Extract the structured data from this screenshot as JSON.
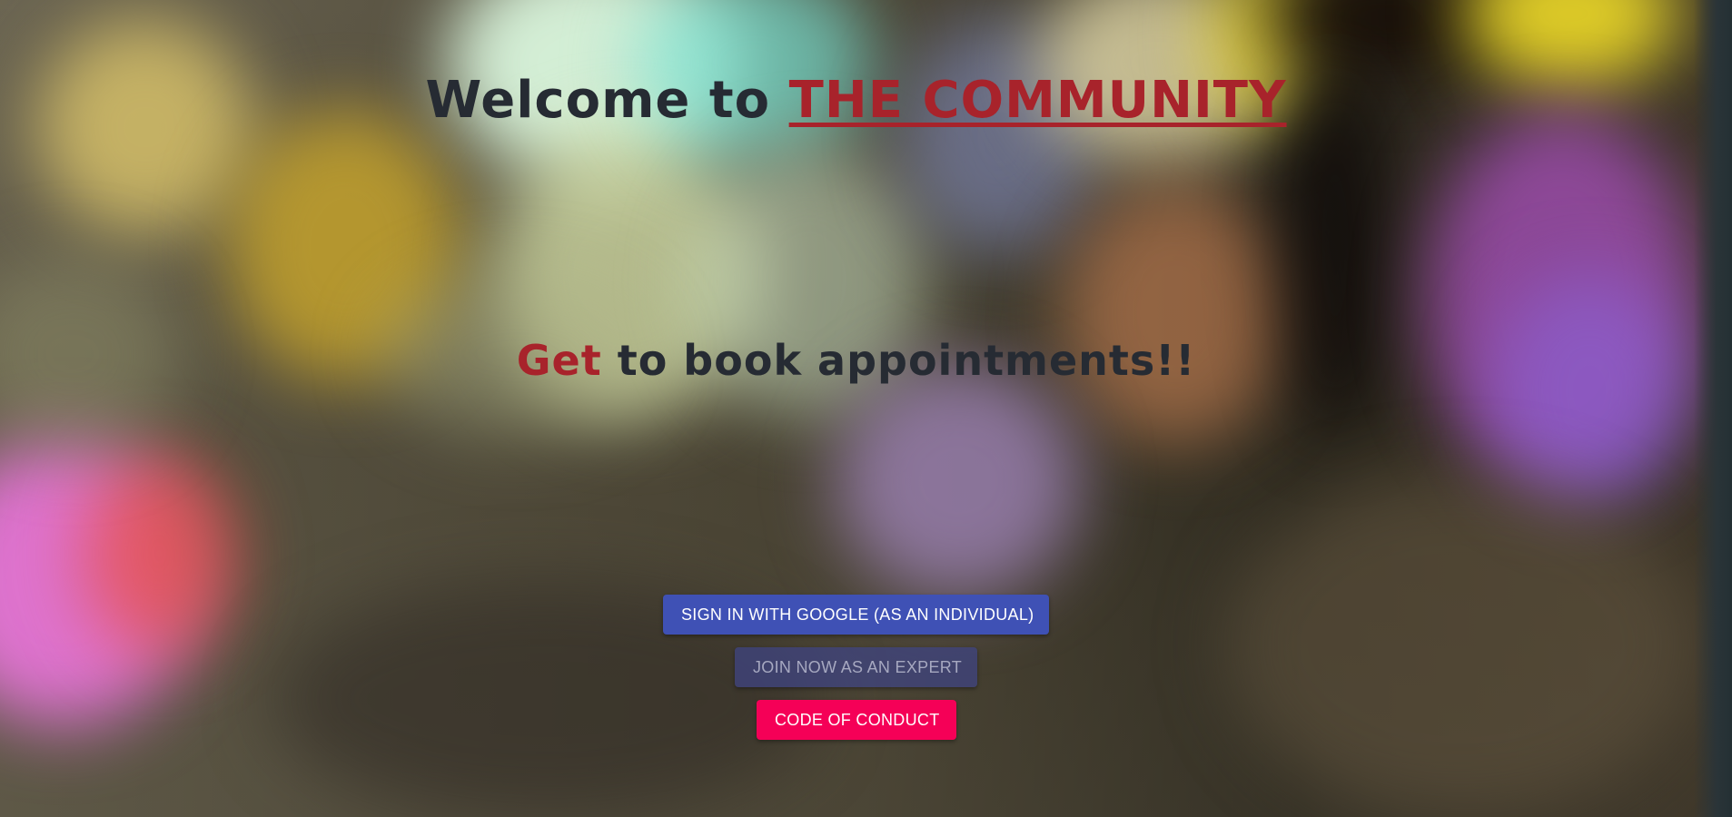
{
  "hero": {
    "welcome_prefix": "Welcome to ",
    "welcome_brand": "THE COMMUNITY",
    "tagline_accent": "Get",
    "tagline_rest": " to book appointments!!"
  },
  "actions": {
    "google_signin_label": "SIGN IN WITH GOOGLE (AS AN INDIVIDUAL)",
    "join_expert_label": "JOIN NOW AS AN EXPERT",
    "code_of_conduct_label": "CODE OF CONDUCT"
  },
  "colors": {
    "brand_red": "#a8232b",
    "heading_dark": "#262b33",
    "google_button": "#3f51b5",
    "expert_button": "#3f4482",
    "conduct_button": "#f50057"
  }
}
